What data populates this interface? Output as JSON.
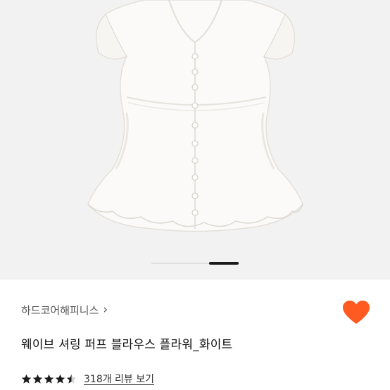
{
  "product": {
    "brand": "하드코어해피니스",
    "title": "웨이브 셔링 퍼프 블라우스 플라워_화이트",
    "rating": 4.5,
    "rating_max": 5,
    "review_link": "318개 리뷰 보기"
  },
  "gallery": {
    "background": "#f2f2f2",
    "current_fraction": 0.67
  },
  "colors": {
    "like": "#ff5a1f",
    "star": "#1a1a1a"
  },
  "icons": {
    "brand_chevron": "chevron-right-icon",
    "like": "heart-icon",
    "rating": "star-icon"
  }
}
